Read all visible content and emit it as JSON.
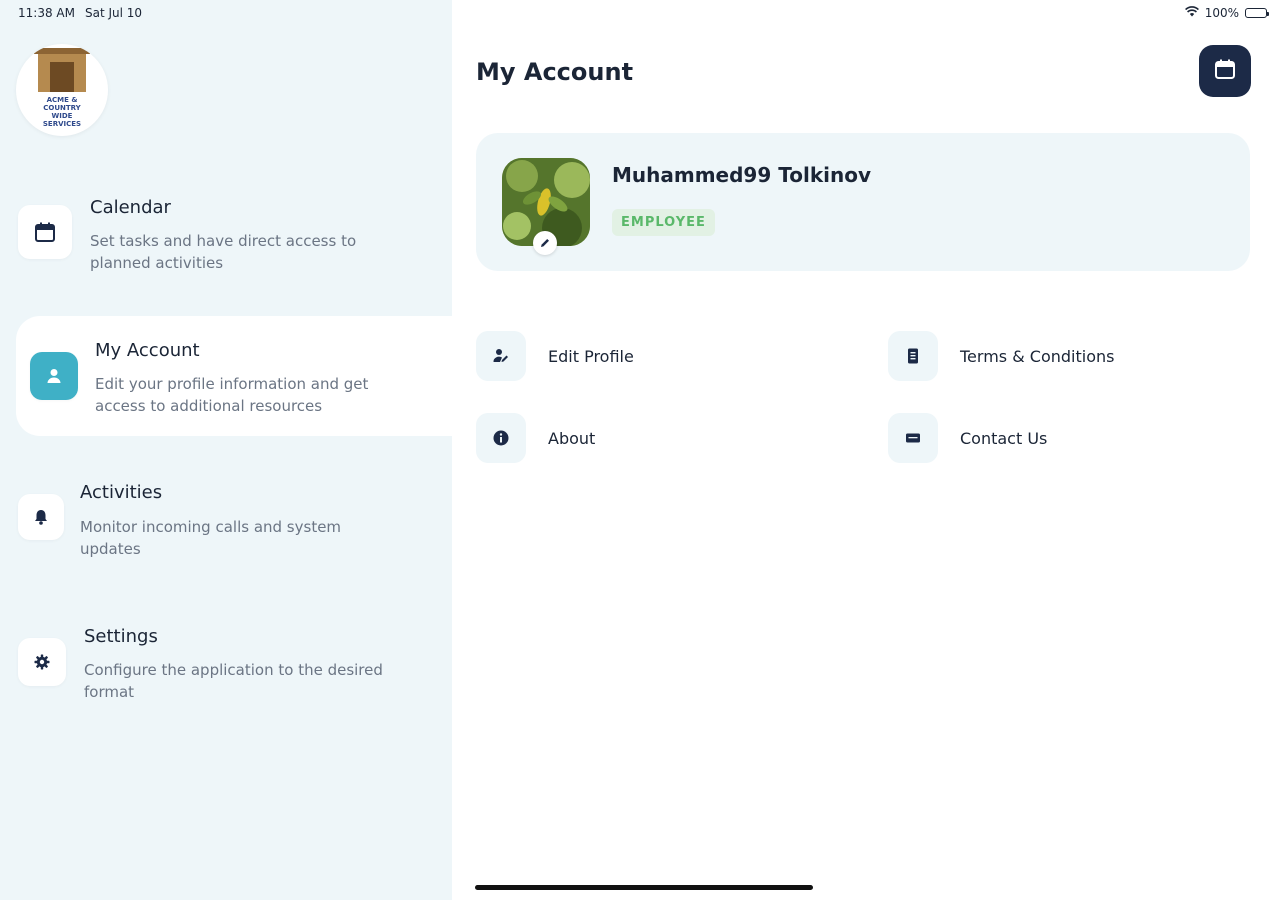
{
  "status_bar": {
    "time": "11:38 AM",
    "date": "Sat Jul 10",
    "battery": "100%"
  },
  "logo": {
    "text": "ACME & COUNTRY WIDE SERVICES"
  },
  "sidebar": {
    "items": [
      {
        "title": "Calendar",
        "description": "Set tasks and have direct access to planned activities",
        "icon": "calendar-icon"
      },
      {
        "title": "My Account",
        "description": "Edit your profile information and get access to additional resources",
        "icon": "person-icon",
        "active": true
      },
      {
        "title": "Activities",
        "description": "Monitor incoming calls and system updates",
        "icon": "bell-icon"
      },
      {
        "title": "Settings",
        "description": "Configure the application to the desired format",
        "icon": "gear-icon"
      }
    ]
  },
  "main": {
    "title": "My Account",
    "profile": {
      "name": "Muhammed99 Tolkinov",
      "role": "EMPLOYEE"
    },
    "menu": [
      {
        "label": "Edit Profile",
        "icon": "edit-profile-icon"
      },
      {
        "label": "Terms & Conditions",
        "icon": "document-icon"
      },
      {
        "label": "About",
        "icon": "info-icon"
      },
      {
        "label": "Contact Us",
        "icon": "mail-icon"
      }
    ]
  },
  "colors": {
    "accent": "#3fb0c6",
    "dark": "#1c2a47",
    "sidebar_bg": "#eef6f9",
    "badge_text": "#5ab86a"
  }
}
